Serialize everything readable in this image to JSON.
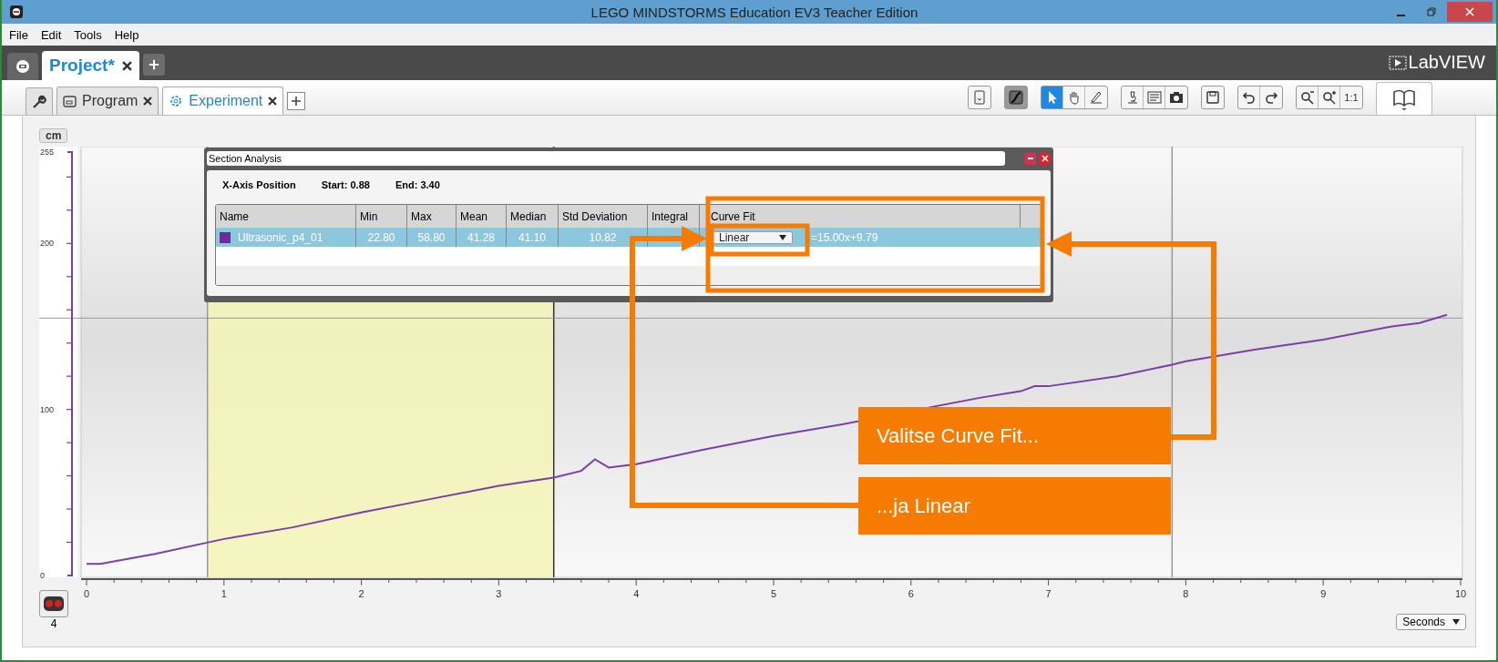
{
  "window": {
    "title": "LEGO MINDSTORMS Education EV3 Teacher Edition"
  },
  "menu": [
    "File",
    "Edit",
    "Tools",
    "Help"
  ],
  "project_tabs": [
    {
      "label": "Project*",
      "selected": true
    }
  ],
  "editor_tabs": [
    {
      "kind": "program",
      "label": "Program",
      "selected": false
    },
    {
      "kind": "experiment",
      "label": "Experiment",
      "selected": true
    }
  ],
  "logo": "LabVIEW",
  "toolbar": [
    [
      {
        "kind": "page",
        "selected": false
      }
    ],
    [
      {
        "kind": "curve",
        "selected": true
      }
    ],
    [
      {
        "kind": "pointer",
        "selected": true
      },
      {
        "kind": "hand",
        "selected": false
      },
      {
        "kind": "pen",
        "selected": false
      }
    ],
    [
      {
        "kind": "microscope",
        "selected": false
      },
      {
        "kind": "notes",
        "selected": false
      },
      {
        "kind": "camera",
        "selected": false
      }
    ],
    [
      {
        "kind": "save",
        "selected": false
      }
    ],
    [
      {
        "kind": "undo",
        "selected": false
      },
      {
        "kind": "redo",
        "selected": false
      }
    ],
    [
      {
        "kind": "zoom_out",
        "selected": false
      },
      {
        "kind": "zoom_in",
        "selected": false
      },
      {
        "kind": "actual_size",
        "label": "1:1",
        "selected": false
      }
    ]
  ],
  "chart": {
    "y_unit": "cm",
    "sensor_port": "4",
    "x_unit_selector": "Seconds",
    "chart_data": {
      "type": "line",
      "xlim": [
        0,
        10
      ],
      "ylim": [
        0,
        255
      ],
      "xticks": [
        0,
        1,
        2,
        3,
        4,
        5,
        6,
        7,
        8,
        9,
        10
      ],
      "yticks": [
        0,
        100,
        200,
        255
      ],
      "x": [
        0,
        0.1,
        0.5,
        1,
        1.5,
        2,
        2.5,
        3,
        3.4,
        3.6,
        3.7,
        3.8,
        4,
        4.5,
        5,
        5.5,
        6,
        6.5,
        6.8,
        6.9,
        7,
        7.5,
        7.9,
        8,
        8.5,
        9,
        9.5,
        9.7,
        9.9
      ],
      "series": [
        {
          "name": "Ultrasonic_p4_01",
          "color": "#7b3fa8",
          "values": [
            7,
            7,
            13,
            22,
            29,
            38,
            46,
            54,
            59,
            63,
            70,
            65,
            67,
            76,
            84,
            91,
            null,
            107,
            111,
            114,
            114,
            120,
            127,
            129,
            136,
            142,
            150,
            152,
            157
          ]
        }
      ],
      "bands": [
        {
          "axis": "x",
          "from": 0.88,
          "to": 3.4
        }
      ],
      "ref_lines": [
        {
          "axis": "x",
          "value": 0.88,
          "color": "#999999"
        },
        {
          "axis": "x",
          "value": 3.4,
          "color": "#333333"
        },
        {
          "axis": "x",
          "value": 7.9,
          "color": "#999999"
        },
        {
          "axis": "y",
          "value": 155,
          "color": "#999999"
        }
      ]
    }
  },
  "section_analysis": {
    "title": "Section Analysis",
    "x_axis_label": "X-Axis Position",
    "start": "Start: 0.88",
    "end": "End: 3.40",
    "columns": [
      "Name",
      "Min",
      "Max",
      "Mean",
      "Median",
      "Std Deviation",
      "Integral",
      "Curve Fit"
    ],
    "rows": [
      {
        "selected": true,
        "color": "#6b2d9a",
        "values": [
          "22.80",
          "58.80",
          "41.28",
          "41.10",
          "10.82"
        ],
        "curve_fit": "Linear",
        "equation": "=15.00x+9.79"
      }
    ]
  },
  "callouts": [
    {
      "text": "Valitse Curve Fit..."
    },
    {
      "text": "...ja Linear"
    }
  ]
}
